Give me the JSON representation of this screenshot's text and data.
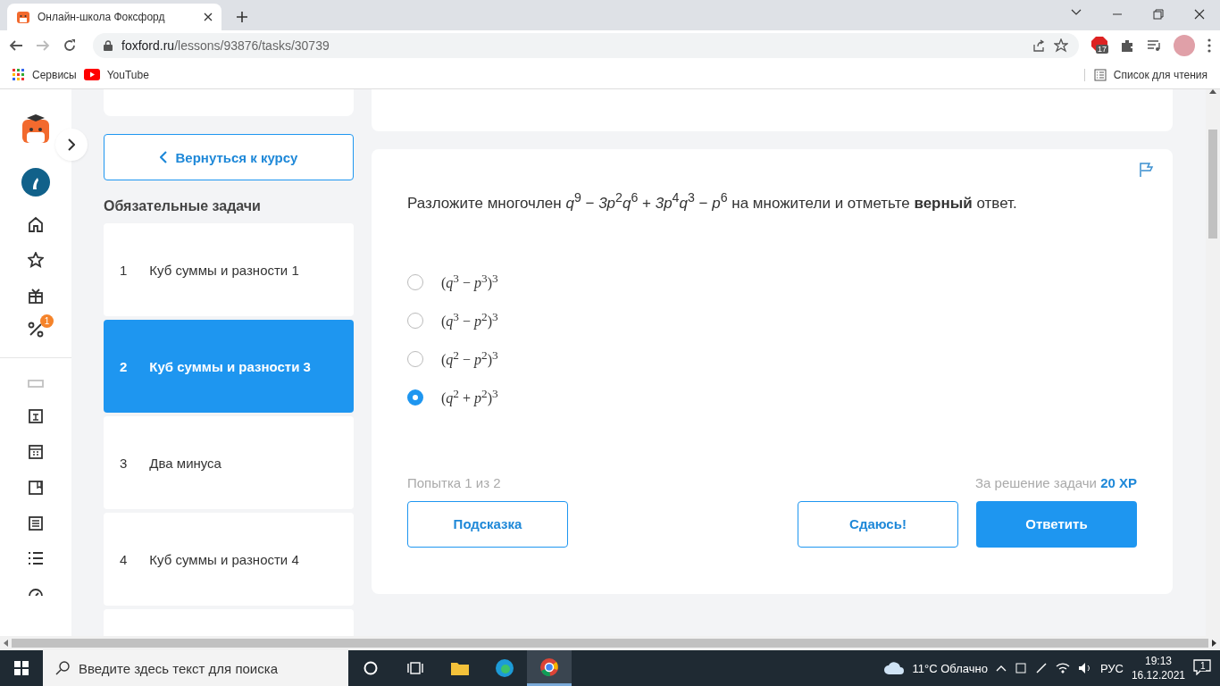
{
  "browser": {
    "tab": {
      "title": "Онлайн-школа Фоксфорд"
    },
    "address": {
      "domain": "foxford.ru",
      "path": "/lessons/93876/tasks/30739"
    },
    "extension_badge": "17",
    "bookmarks": [
      "Сервисы",
      "YouTube"
    ],
    "reading_list": "Список для чтения"
  },
  "rail": {
    "badge": "1"
  },
  "tasks": {
    "back_button": "Вернуться к курсу",
    "heading": "Обязательные задачи",
    "items": [
      {
        "number": "1",
        "title": "Куб суммы и разности 1",
        "selected": false
      },
      {
        "number": "2",
        "title": "Куб суммы и разности 3",
        "selected": true
      },
      {
        "number": "3",
        "title": "Два минуса",
        "selected": false
      },
      {
        "number": "4",
        "title": "Куб суммы и разности 4",
        "selected": false
      }
    ]
  },
  "task": {
    "question": "Разложите многочлен *q*$^{9}$ − *3p*$^{2}$*q*$^{6}$ + *3p*$^{4}$*q*$^{3}$ − *p*$^{6}$ на множители и отметьте **верный** ответ.",
    "options": [
      {
        "formula": "(*q*$^{3}$ − *p*$^{3}$)$^{3}$",
        "selected": false
      },
      {
        "formula": "(*q*$^{3}$ − *p*$^{2}$)$^{3}$",
        "selected": false
      },
      {
        "formula": "(*q*$^{2}$ − *p*$^{2}$)$^{3}$",
        "selected": false
      },
      {
        "formula": "(*q*$^{2}$ + *p*$^{2}$)$^{3}$",
        "selected": true
      }
    ],
    "attempt": "Попытка 1 из 2",
    "reward_label": "За решение задачи",
    "reward_value": "20 XP",
    "buttons": [
      {
        "kind": "outline",
        "label": "Подсказка"
      },
      {
        "kind": "outline",
        "label": "Сдаюсь!"
      },
      {
        "kind": "primary",
        "label": "Ответить"
      }
    ]
  },
  "taskbar": {
    "search_placeholder": "Введите здесь текст для поиска",
    "weather": "11°C Облачно",
    "language": "РУС",
    "time": "19:13",
    "date": "16.12.2021",
    "notifications": "1"
  }
}
